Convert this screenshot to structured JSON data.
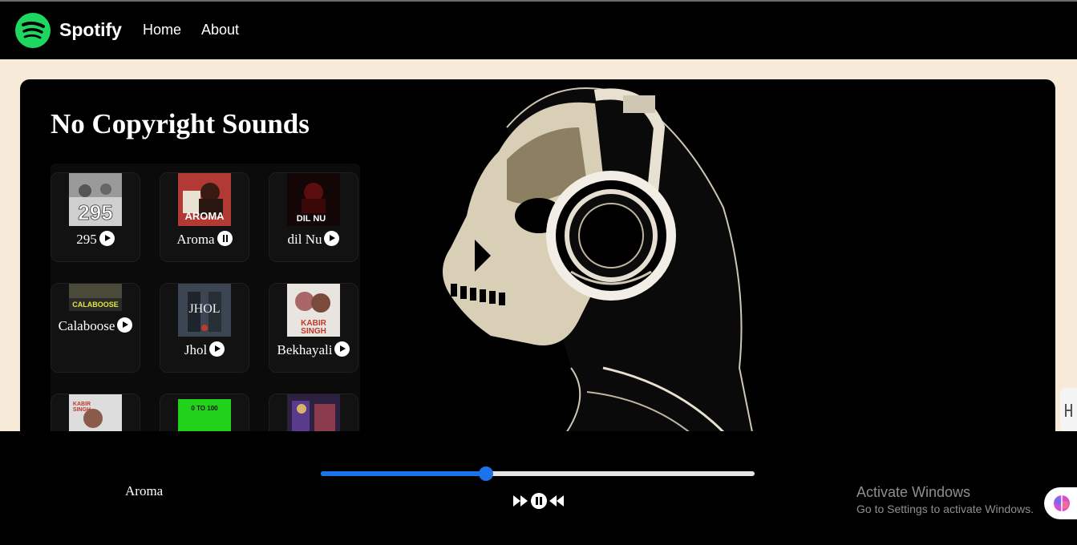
{
  "nav": {
    "brand": "Spotify",
    "links": [
      "Home",
      "About"
    ]
  },
  "main": {
    "title": "No Copyright Sounds",
    "songs": [
      {
        "name": "295",
        "cover_text": "295",
        "cover_color": "#d9d9d9",
        "state": "play"
      },
      {
        "name": "Aroma",
        "cover_text": "AROMA",
        "cover_color": "#b73b3b",
        "state": "pause"
      },
      {
        "name": "dil Nu",
        "cover_text": "DIL NU",
        "cover_color": "#1a0a0a",
        "state": "play"
      },
      {
        "name": "Calaboose",
        "cover_text": "CALABOOSE",
        "cover_color": "#2c2c2c",
        "state": "play"
      },
      {
        "name": "Jhol",
        "cover_text": "JHOL",
        "cover_color": "#3a4a5a",
        "state": "play"
      },
      {
        "name": "Bekhayali",
        "cover_text": "KABIR SINGH",
        "cover_color": "#e5e5e5",
        "state": "play"
      },
      {
        "name": "",
        "cover_text": "KABIR SINGH",
        "cover_color": "#d8d8d8",
        "state": "none"
      },
      {
        "name": "",
        "cover_text": "0 TO 100",
        "cover_color": "#22d11a",
        "state": "none"
      },
      {
        "name": "",
        "cover_text": "",
        "cover_color": "#4a3a6a",
        "state": "none"
      }
    ]
  },
  "player": {
    "now_playing": "Aroma",
    "progress": 0.38,
    "accent": "#1a73e8"
  },
  "watermark": {
    "line1": "Activate Windows",
    "line2": "Go to Settings to activate Windows."
  },
  "colors": {
    "brand_green": "#1ed760",
    "page_bg": "#f8ead8"
  }
}
